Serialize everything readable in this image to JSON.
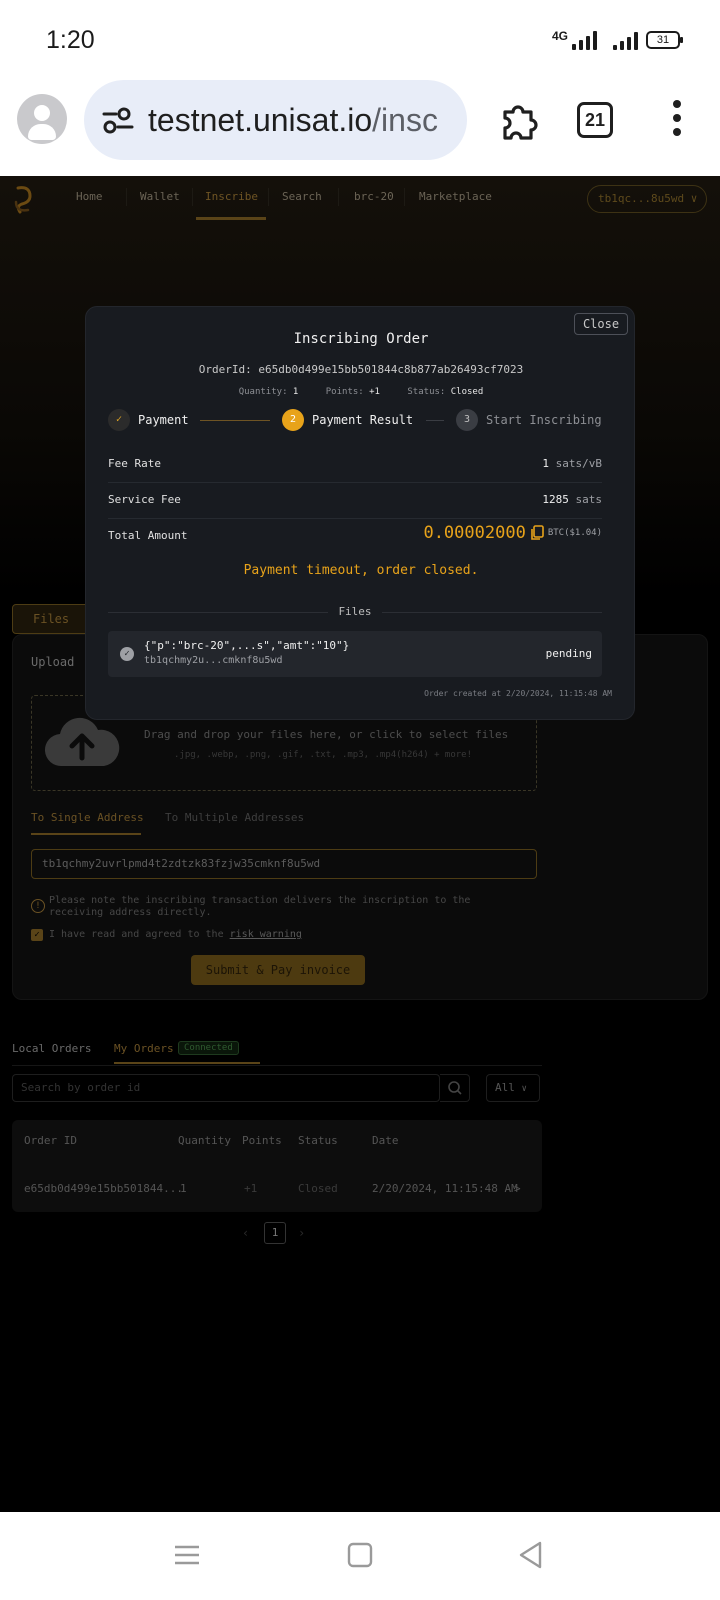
{
  "status_bar": {
    "time": "1:20",
    "network": "4G",
    "battery": "31"
  },
  "browser": {
    "url_domain": "testnet.unisat.io",
    "url_path": "/insc",
    "tab_count": "21"
  },
  "site_nav": {
    "items": [
      {
        "label": "Home"
      },
      {
        "label": "Wallet"
      },
      {
        "label": "Inscribe"
      },
      {
        "label": "Search"
      },
      {
        "label": "brc-20"
      },
      {
        "label": "Marketplace"
      }
    ],
    "active": "Inscribe",
    "wallet_label": "tb1qc...8u5wd ∨"
  },
  "inscribe_form": {
    "tab_label": "Files",
    "upload_label": "Upload",
    "drop_text": "Drag and drop your files here, or click to select files",
    "drop_sub": ".jpg, .webp, .png, .gif, .txt, .mp3, .mp4(h264) + more!",
    "address_tabs": [
      "To Single Address",
      "To Multiple Addresses"
    ],
    "address_value": "tb1qchmy2uvrlpmd4t2zdtzk83fzjw35cmknf8u5wd",
    "note": "Please note the inscribing transaction delivers the inscription to the receiving address directly.",
    "agree_text": "I have read and agreed to the",
    "agree_link": "risk warning",
    "submit_label": "Submit & Pay invoice"
  },
  "orders": {
    "tabs": [
      "Local Orders",
      "My Orders"
    ],
    "connected_badge": "Connected",
    "search_placeholder": "Search by order id",
    "filter_value": "All",
    "columns": [
      "Order ID",
      "Quantity",
      "Points",
      "Status",
      "Date"
    ],
    "rows": [
      {
        "order_id": "e65db0d499e15bb501844...",
        "quantity": "1",
        "points": "+1",
        "status": "Closed",
        "date": "2/20/2024, 11:15:48 AM"
      }
    ],
    "page": "1"
  },
  "modal": {
    "close_label": "Close",
    "title": "Inscribing Order",
    "order_id": "OrderId: e65db0d499e15bb501844c8b877ab26493cf7023",
    "quantity_label": "Quantity:",
    "quantity": "1",
    "points_label": "Points:",
    "points": "+1",
    "status_label": "Status:",
    "status": "Closed",
    "steps": [
      {
        "number": "✓",
        "label": "Payment",
        "state": "done"
      },
      {
        "number": "2",
        "label": "Payment Result",
        "state": "active"
      },
      {
        "number": "3",
        "label": "Start Inscribing",
        "state": "todo"
      }
    ],
    "fee_rate_label": "Fee Rate",
    "fee_rate_value": "1",
    "fee_rate_unit": "sats/vB",
    "service_fee_label": "Service Fee",
    "service_fee_value": "1285",
    "service_fee_unit": "sats",
    "total_label": "Total Amount",
    "total_value": "0.00002000",
    "total_unit": "BTC($1.04)",
    "timeout_message": "Payment timeout, order closed.",
    "files_label": "Files",
    "file": {
      "name": "{\"p\":\"brc-20\",...s\",\"amt\":\"10\"}",
      "address": "tb1qchmy2u...cmknf8u5wd",
      "status": "pending"
    },
    "created_at": "Order created at 2/20/2024, 11:15:48 AM"
  },
  "colors": {
    "accent": "#e8a31a",
    "modal_bg": "#181b20",
    "page_bg": "#000000"
  }
}
